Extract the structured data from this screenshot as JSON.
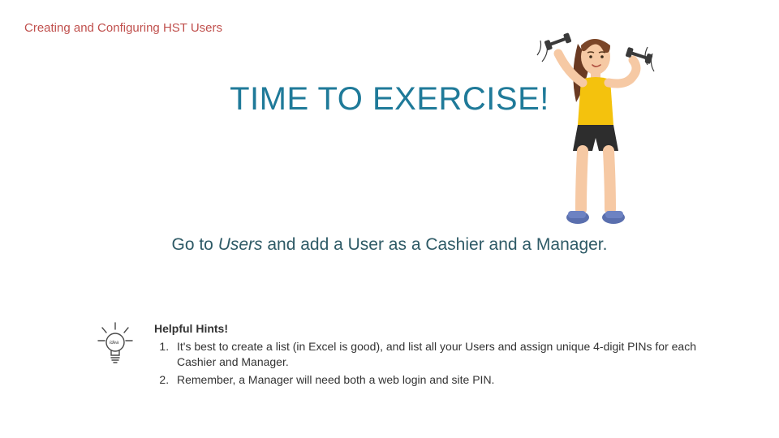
{
  "breadcrumb": "Creating  and Configuring HST Users",
  "title": "TIME TO EXERCISE!",
  "instruction": {
    "lead": "Go to ",
    "emphasis": "Users",
    "tail": " and add a User as a Cashier and a Manager."
  },
  "hints": {
    "heading": "Helpful Hints!",
    "items": [
      "It's best to create a list (in Excel is good), and list all your Users and assign unique 4-digit PINs for each Cashier and Manager.",
      "Remember, a Manager will need both a web login and site PIN."
    ]
  },
  "icons": {
    "bulb": "idea-bulb-icon",
    "figure": "woman-exercising-icon"
  }
}
